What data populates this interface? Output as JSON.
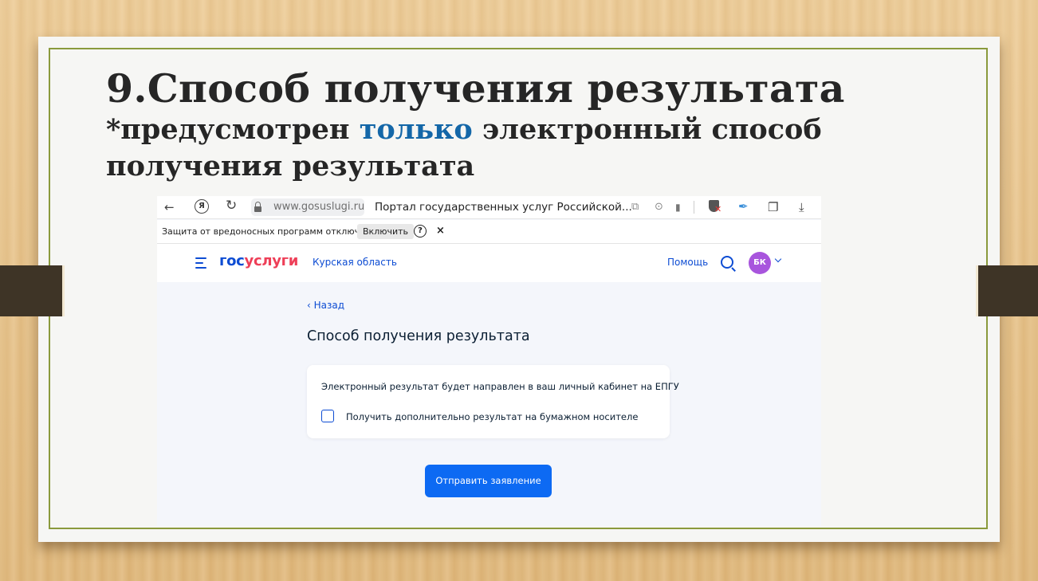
{
  "slide": {
    "title": "9.Способ получения результата",
    "subtitle_before": "*предусмотрен ",
    "subtitle_highlight": "только",
    "subtitle_after": " электронный способ получения результата",
    "highlight_color": "#1467a8",
    "frame_color": "#8a9a3c"
  },
  "browser": {
    "back_glyph": "←",
    "yandex_glyph": "Я",
    "reload_glyph": "↻",
    "url": "www.gosuslugi.ru",
    "tab_title": "Портал государственных услуг Российской...",
    "shield_x_glyph": "✕",
    "feather_glyph": "✒",
    "download_glyph": "⤓",
    "bookmark_glyph": "▮",
    "extensions_glyph": "❐",
    "zoom_glyph": "⊙",
    "copy_glyph": "⧉",
    "warning": {
      "text": "Защита от вредоносных программ отключена",
      "enable_label": "Включить",
      "help_glyph": "?",
      "close_glyph": "×"
    }
  },
  "site": {
    "logo_part1": "гос",
    "logo_part2": "услуги",
    "logo_colors": {
      "part1": "#0d4cd3",
      "part2": "#ee3f58"
    },
    "region": "Курская область",
    "help": "Помощь",
    "avatar_initials": "БК",
    "avatar_color": "#a855dd"
  },
  "form": {
    "back": "‹ Назад",
    "title": "Способ получения результата",
    "info": "Электронный результат будет направлен в ваш личный кабинет на ЕПГУ",
    "checkbox_label": "Получить дополнительно результат на бумажном носителе",
    "checkbox_checked": false,
    "submit": "Отправить заявление",
    "accent_color": "#0d6af3"
  }
}
